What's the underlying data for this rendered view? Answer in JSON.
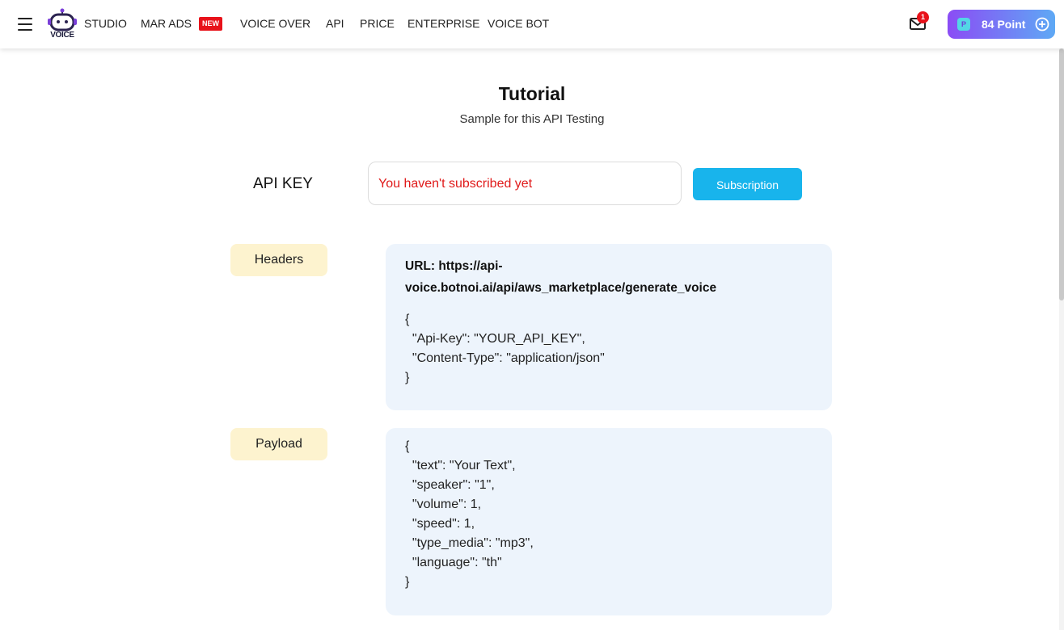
{
  "nav": {
    "brand_text": "VOICE",
    "items": [
      "STUDIO",
      "MAR ADS",
      "VOICE OVER",
      "API",
      "PRICE",
      "ENTERPRISE",
      "VOICE BOT"
    ],
    "new_badge": "NEW",
    "mail_count": "1",
    "points_label": "84 Point",
    "points_gem_letter": "P"
  },
  "main": {
    "title": "Tutorial",
    "subtitle": "Sample for this API Testing"
  },
  "api_key": {
    "label": "API KEY",
    "value": "You haven't subscribed yet",
    "button_label": "Subscription"
  },
  "headers": {
    "tag": "Headers",
    "url_text": "URL: https://api-voice.botnoi.ai/api/aws_marketplace/generate_voice",
    "lines": [
      "{",
      "  \"Api-Key\": \"YOUR_API_KEY\",",
      "  \"Content-Type\": \"application/json\"",
      "}"
    ]
  },
  "payload": {
    "tag": "Payload",
    "lines": [
      "{",
      "  \"text\": \"Your Text\",",
      "  \"speaker\": \"1\",",
      "  \"volume\": 1,",
      "  \"speed\": 1,",
      "  \"type_media\": \"mp3\",",
      "  \"language\": \"th\"",
      "}"
    ]
  },
  "colors": {
    "accent": "#18b4ec",
    "error_text": "#e01b1b",
    "tag_bg": "#fdf3cf",
    "card_bg": "#edf4fc",
    "badge_red": "#e8121a"
  }
}
